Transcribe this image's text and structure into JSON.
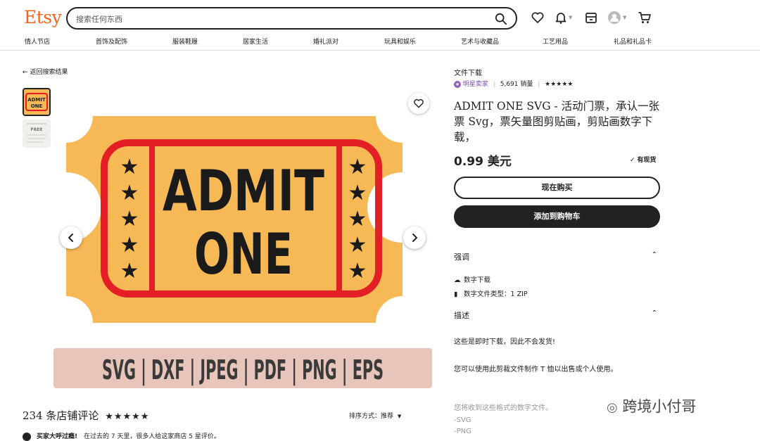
{
  "header": {
    "logo": "Etsy",
    "search_placeholder": "搜索任何东西"
  },
  "categories": [
    "情人节店",
    "首饰及配饰",
    "服装鞋履",
    "居家生活",
    "婚礼派对",
    "玩具和娱乐",
    "艺术与收藏品",
    "工艺用品",
    "礼品和礼品卡"
  ],
  "back_link": "返回搜索结果",
  "gallery": {
    "ticket_line1": "ADMIT",
    "ticket_line2": "ONE",
    "formats_banner": "SVG | DXF | JPEG | PDF | PNG | EPS",
    "thumb2_label": "FREE",
    "colors": {
      "ticket": "#f7b955",
      "frame": "#e31e24",
      "banner": "#e8c5bb"
    }
  },
  "product": {
    "type_label": "文件下载",
    "star_seller": "明星卖家",
    "sales": "5,691 销量",
    "rating_stars": "★★★★★",
    "title": "ADMIT ONE SVG - 活动门票，承认一张票 Svg，票矢量图剪贴画，剪贴画数字下载，",
    "price": "0.99 美元",
    "in_stock": "有现货",
    "buy_now": "现在购买",
    "add_to_cart": "添加到购物车"
  },
  "highlights": {
    "title": "强调",
    "items": [
      "数字下载",
      "数字文件类型：1 ZIP"
    ]
  },
  "description": {
    "title": "描述",
    "line1": "这些是即时下载，因此不会发货!",
    "line2": "您可以使用此剪裁文件制作 T 恤以出售或个人使用。",
    "line3": "您将收到这些格式的数字文件。",
    "formats": [
      "-SVG",
      "-PNG"
    ]
  },
  "reviews": {
    "title": "234 条店铺评论",
    "stars": "★★★★★",
    "sort_label": "排序方式：推荐",
    "highlight_bold": "买家大呼过瘾!",
    "highlight_text": "在过去的 7 天里，很多人给这家商店 5 星评价。"
  },
  "watermark": "跨境小付哥"
}
